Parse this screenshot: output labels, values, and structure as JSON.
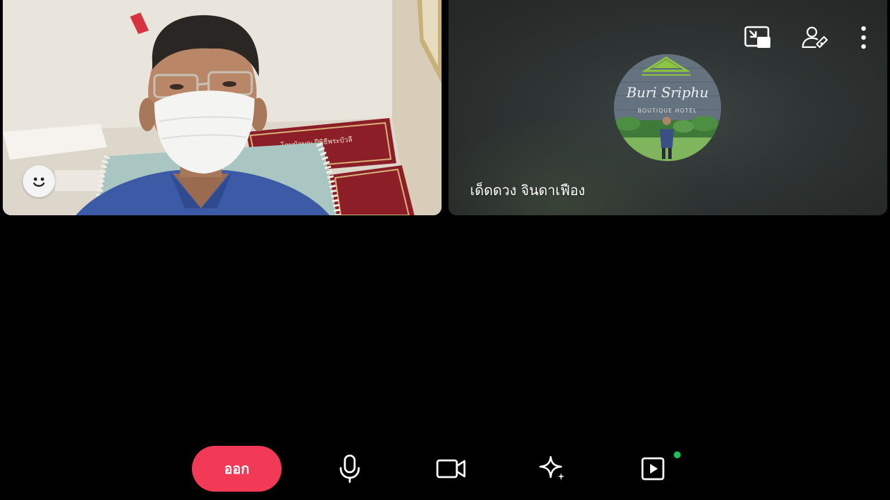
{
  "call": {
    "leave_label": "ออก"
  },
  "participants": {
    "self": {
      "reaction_icon": "smiley-face-icon",
      "sign_text": "โลบนักบุญ ปีพิธีพระบัวลี"
    },
    "remote": {
      "name": "เด็ดดวง จินดาเฟือง",
      "avatar_text_line1": "Buri Sriphu",
      "avatar_text_line2": "BOUTIQUE HOTEL"
    }
  },
  "toolbar": {
    "items": [
      {
        "icon": "microphone-icon"
      },
      {
        "icon": "video-camera-icon"
      },
      {
        "icon": "sparkle-effects-icon"
      },
      {
        "icon": "share-play-icon",
        "has_notification": true
      }
    ],
    "remote_tools": [
      {
        "icon": "picture-in-picture-icon"
      },
      {
        "icon": "edit-participant-icon"
      },
      {
        "icon": "more-vertical-icon"
      }
    ]
  },
  "colors": {
    "leave_button": "#f23a56",
    "notification_dot": "#19c15a",
    "background": "#000000"
  }
}
